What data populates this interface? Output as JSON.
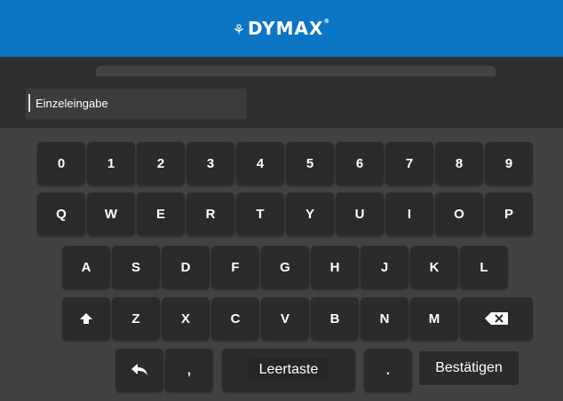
{
  "header": {
    "brand": "DYMAX",
    "brand_color": "#0d76c4"
  },
  "input": {
    "value": "Einzeleingabe"
  },
  "keyboard": {
    "row_digits": [
      "0",
      "1",
      "2",
      "3",
      "4",
      "5",
      "6",
      "7",
      "8",
      "9"
    ],
    "row_q": [
      "Q",
      "W",
      "E",
      "R",
      "T",
      "Y",
      "U",
      "I",
      "O",
      "P"
    ],
    "row_a": [
      "A",
      "S",
      "D",
      "F",
      "G",
      "H",
      "J",
      "K",
      "L"
    ],
    "row_z": [
      "Z",
      "X",
      "C",
      "V",
      "B",
      "N",
      "M"
    ],
    "comma": ",",
    "space_label": "Leertaste",
    "period": ".",
    "confirm_label": "Bestätigen",
    "icons": {
      "shift": "shift-icon",
      "backspace": "backspace-icon",
      "back": "back-arrow-icon"
    }
  }
}
